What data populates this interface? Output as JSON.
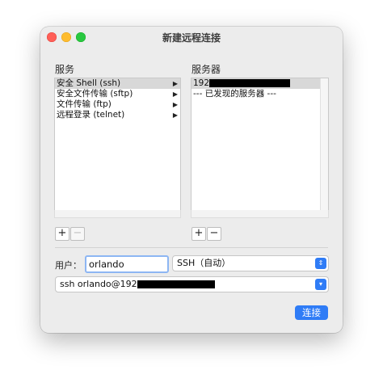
{
  "window": {
    "title": "新建远程连接"
  },
  "services": {
    "label": "服务",
    "items": [
      {
        "label": "安全 Shell (ssh)",
        "selected": true
      },
      {
        "label": "安全文件传输 (sftp)",
        "selected": false
      },
      {
        "label": "文件传输 (ftp)",
        "selected": false
      },
      {
        "label": "远程登录 (telnet)",
        "selected": false
      }
    ]
  },
  "servers": {
    "label": "服务器",
    "items": [
      {
        "label": "192",
        "redacted": true,
        "selected": true
      },
      {
        "label": "--- 已发现的服务器 ---",
        "redacted": false,
        "selected": false
      }
    ]
  },
  "buttons": {
    "add": "+",
    "remove": "−",
    "connect": "连接"
  },
  "user": {
    "label": "用户：",
    "value": "orlando"
  },
  "protocol": {
    "selected": "SSH（自动）"
  },
  "command": {
    "value": "ssh orlando@192"
  },
  "icons": {
    "stepper": "up-down-chevron-icon",
    "dropdown": "chevron-down-icon",
    "submenu": "triangle-right-icon"
  }
}
